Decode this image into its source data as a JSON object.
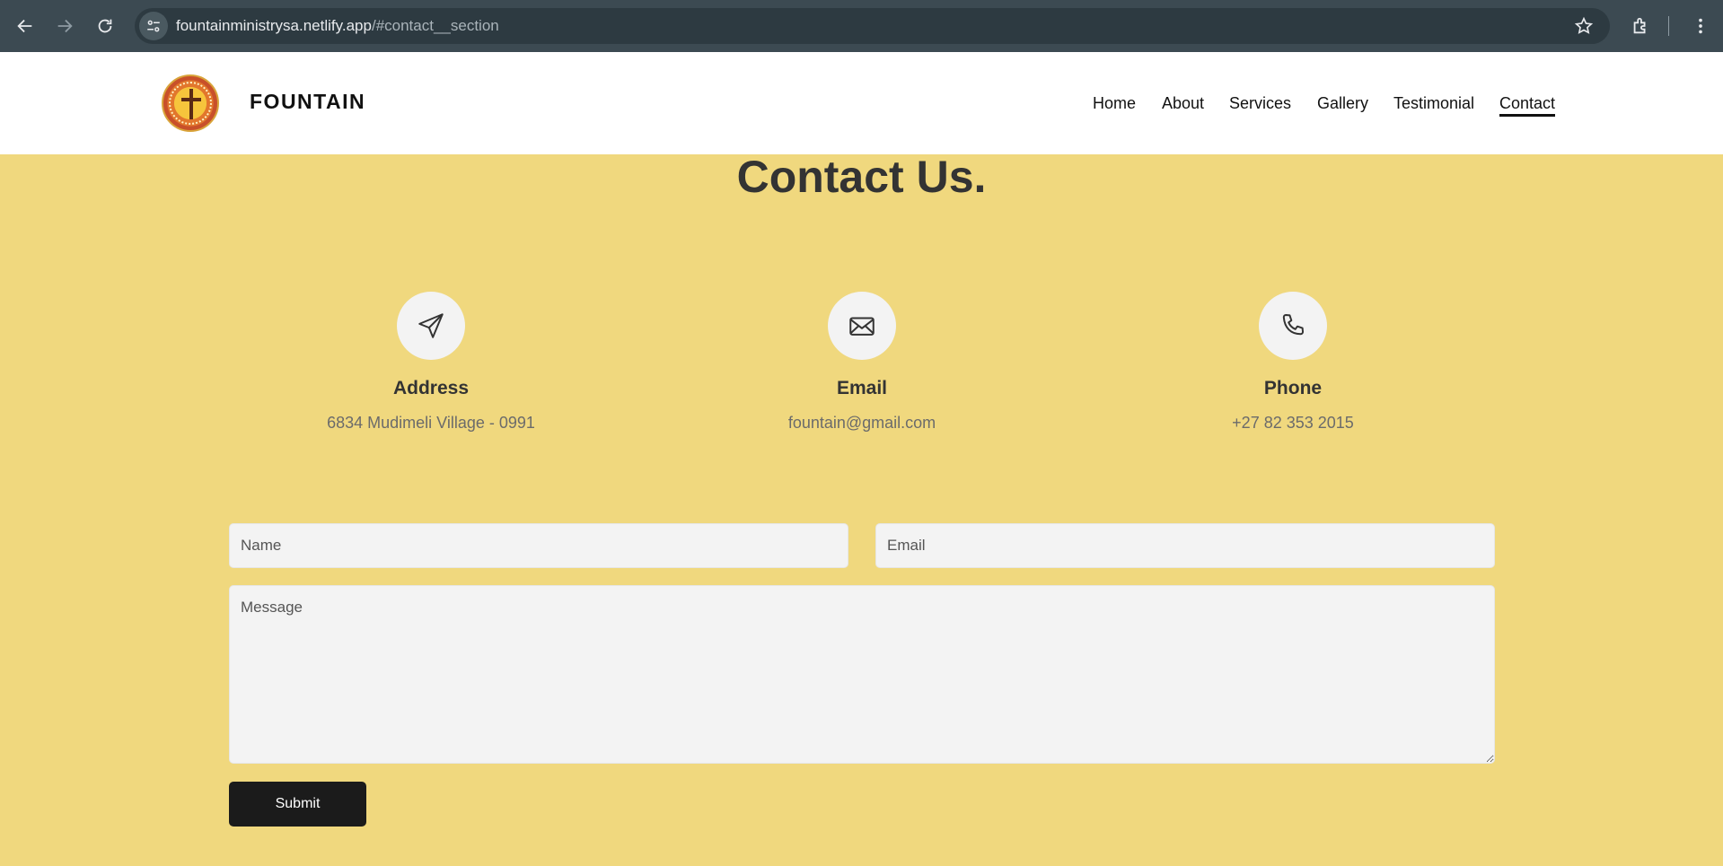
{
  "browser": {
    "url_host": "fountainministrysa.netlify.app",
    "url_path": "/#contact__section"
  },
  "header": {
    "brand": "FOUNTAIN",
    "nav": [
      {
        "label": "Home",
        "active": false
      },
      {
        "label": "About",
        "active": false
      },
      {
        "label": "Services",
        "active": false
      },
      {
        "label": "Gallery",
        "active": false
      },
      {
        "label": "Testimonial",
        "active": false
      },
      {
        "label": "Contact",
        "active": true
      }
    ]
  },
  "contact": {
    "title": "Contact Us.",
    "info": [
      {
        "icon": "paper-plane-icon",
        "title": "Address",
        "value": "6834 Mudimeli Village - 0991"
      },
      {
        "icon": "envelope-icon",
        "title": "Email",
        "value": "fountain@gmail.com"
      },
      {
        "icon": "phone-icon",
        "title": "Phone",
        "value": "+27 82 353 2015"
      }
    ],
    "form": {
      "name_placeholder": "Name",
      "email_placeholder": "Email",
      "message_placeholder": "Message",
      "submit_label": "Submit"
    }
  },
  "colors": {
    "section_background": "#f0d87e",
    "button_background": "#1b1b1b",
    "chrome_background": "#3c4a52"
  }
}
